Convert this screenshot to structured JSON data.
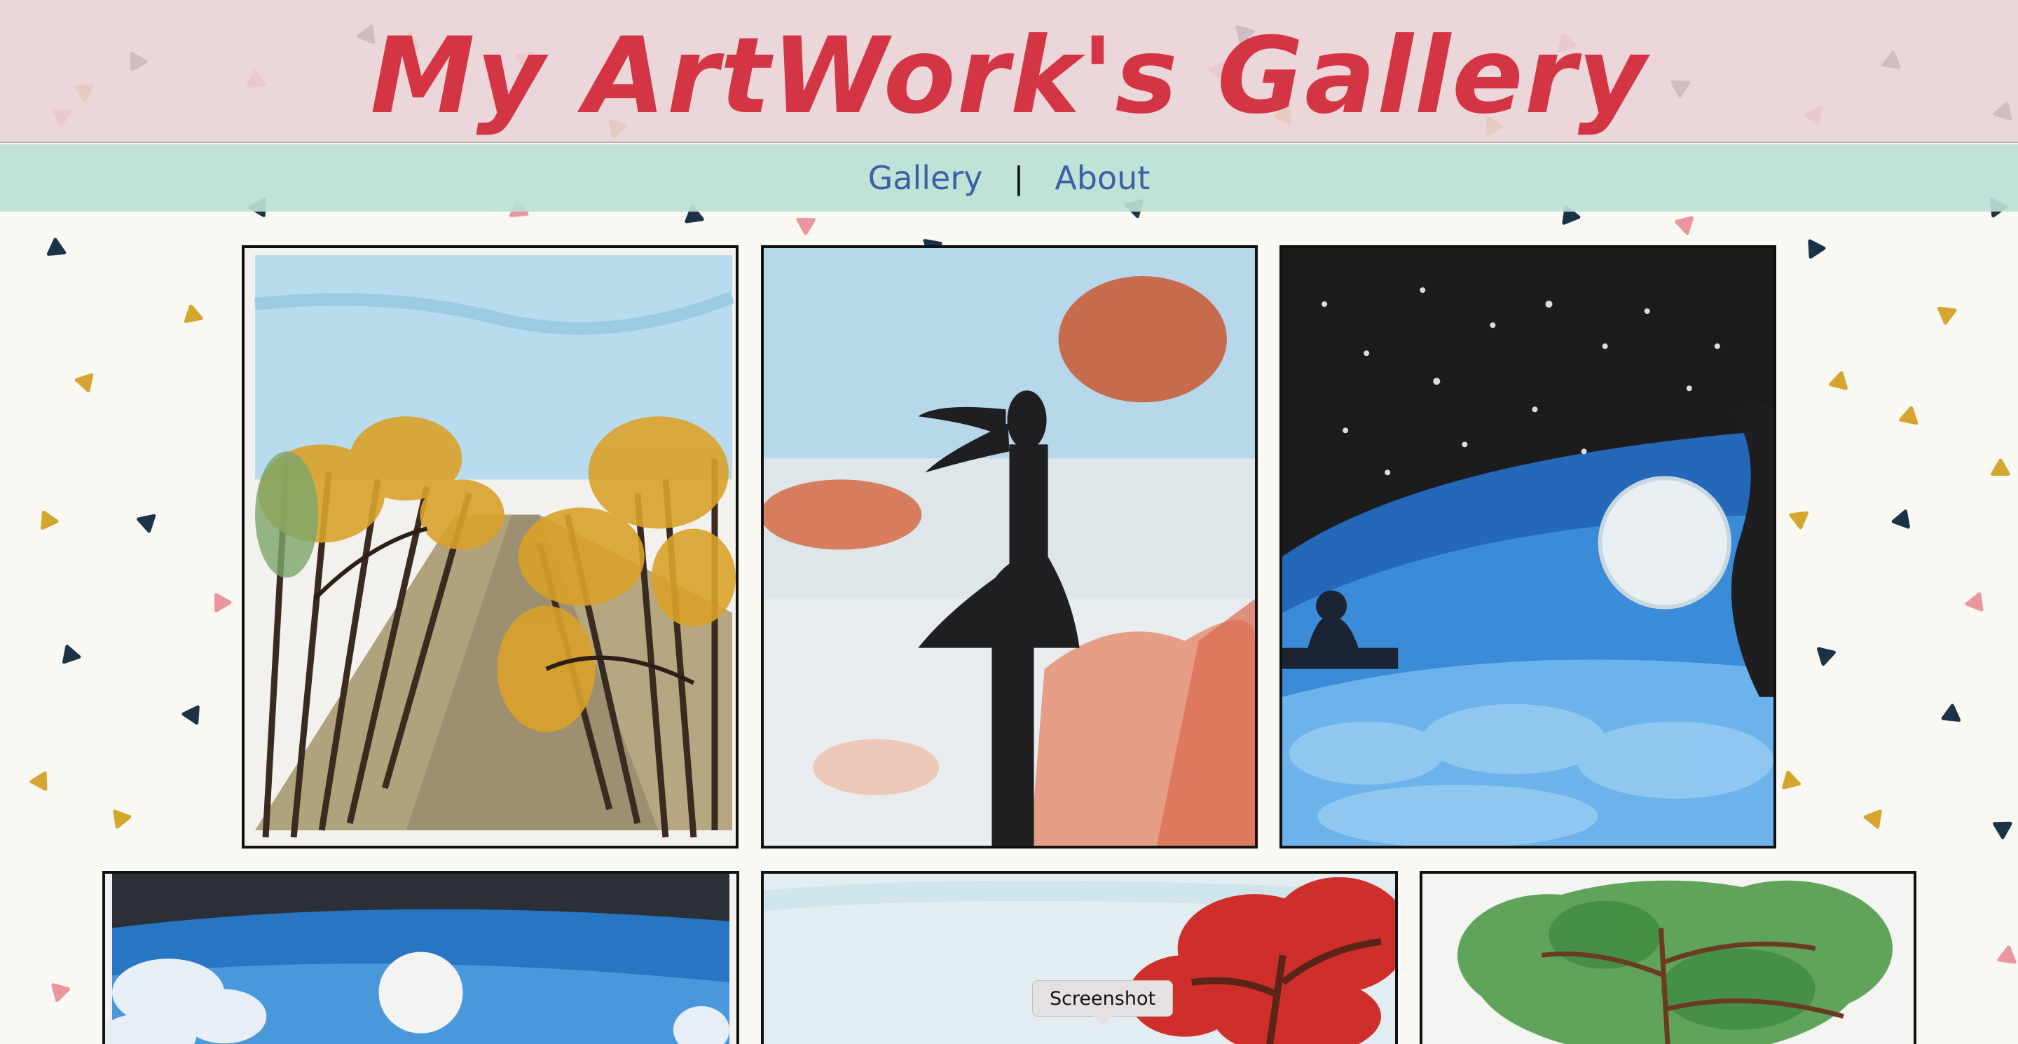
{
  "header": {
    "title": "My ArtWork's Gallery",
    "title_color": "#d33545",
    "background": "#e8d0d6"
  },
  "nav": {
    "background": "#bbe0d5",
    "link_color": "#3c5fa5",
    "items": [
      {
        "label": "Gallery"
      },
      {
        "label": "About"
      }
    ],
    "separator": "|"
  },
  "gallery": {
    "artworks": [
      {
        "subject": "autumn road lined with trees"
      },
      {
        "subject": "girl silhouette with wind-blown hair"
      },
      {
        "subject": "night sky with full moon over clouds"
      },
      {
        "subject": "blue night with moon and snowy trees"
      },
      {
        "subject": "red blossoming tree"
      },
      {
        "subject": "green tree"
      }
    ]
  },
  "tooltip": {
    "text": "Screenshot"
  },
  "background_pattern": {
    "colors": [
      "#1c3347",
      "#d4a62e",
      "#e9969f"
    ]
  }
}
